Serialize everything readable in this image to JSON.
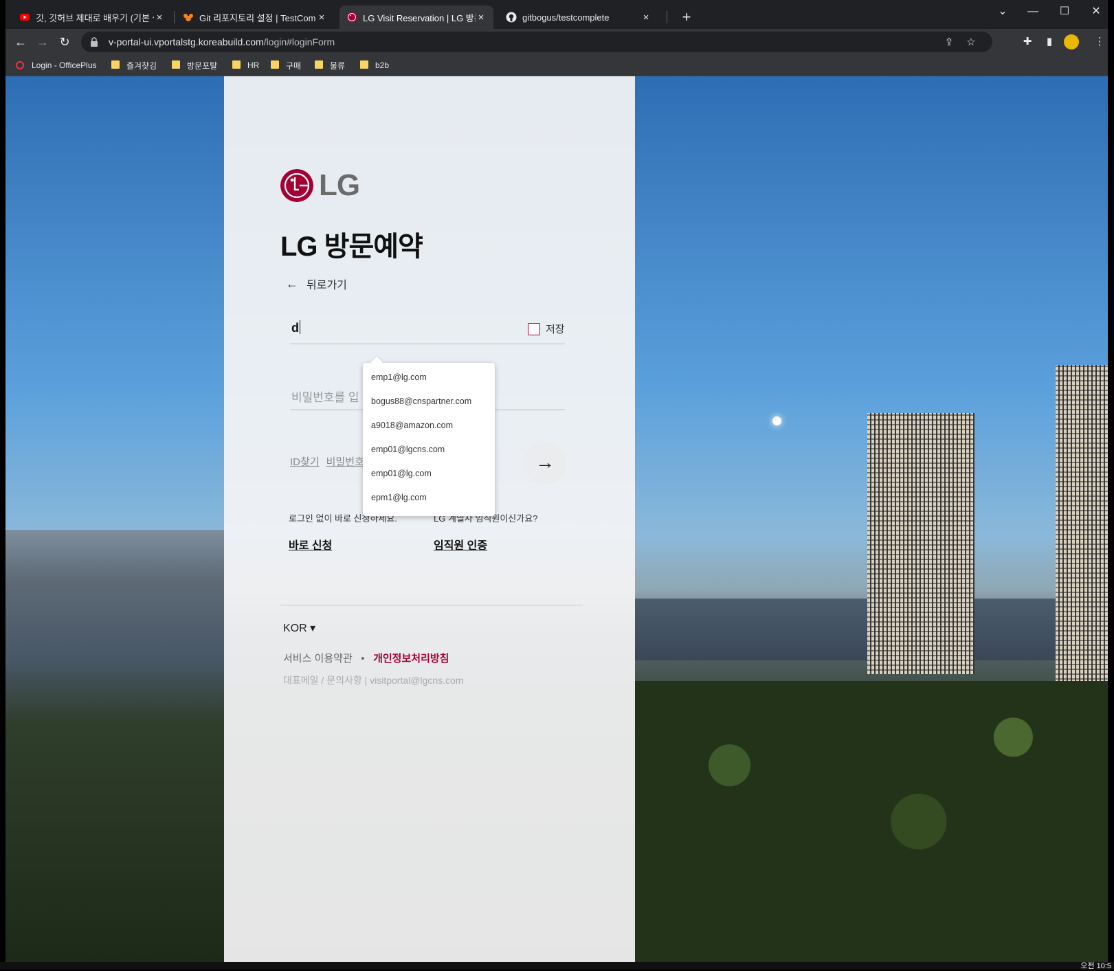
{
  "tabs": [
    {
      "title": "깃, 깃허브 제대로 배우기 (기본 실",
      "close": "×"
    },
    {
      "title": "Git 리포지토리 설정 | TestCompl",
      "close": "×"
    },
    {
      "title": "LG Visit Reservation | LG 방문 예",
      "close": "×"
    },
    {
      "title": "gitbogus/testcomplete",
      "close": "×"
    }
  ],
  "new_tab": "+",
  "window_controls": {
    "dropdown": "⌄",
    "minimize": "—",
    "maximize": "☐",
    "close": "✕"
  },
  "address_bar": {
    "host": "v-portal-ui.vportalstg.koreabuild.com",
    "path": "/login#loginForm"
  },
  "bookmarks": [
    "Login - OfficePlus",
    "즐겨찾깅",
    "방문포탈",
    "HR",
    "구매",
    "물류",
    "b2b"
  ],
  "login": {
    "logo_text": "LG",
    "heading": "LG 방문예약",
    "back_label": "뒤로가기",
    "id_value": "d",
    "save_label": "저장",
    "password_placeholder": "비밀번호를 입",
    "find_id": "ID찾기",
    "find_pw": "비밀번호",
    "go_arrow": "→",
    "no_login_text": "로그인 없이 바로 신청하세요.",
    "direct_apply": "바로 신청",
    "employee_text": "LG 계열사 임직원이신가요?",
    "employee_auth": "임직원 인증",
    "language": "KOR ▾",
    "terms": "서비스 이용약관",
    "bullet": "•",
    "privacy": "개인정보처리방침",
    "contact": "대표메일 / 문의사항 | visitportal@lgcns.com"
  },
  "autocomplete": [
    "emp1@lg.com",
    "bogus88@cnspartner.com",
    "a9018@amazon.com",
    "emp01@lgcns.com",
    "emp01@lg.com",
    "epm1@lg.com"
  ],
  "taskbar_clock": "오전 10:5",
  "colors": {
    "brand": "#a50034",
    "chrome_dark": "#202124",
    "chrome_toolbar": "#35363a"
  }
}
